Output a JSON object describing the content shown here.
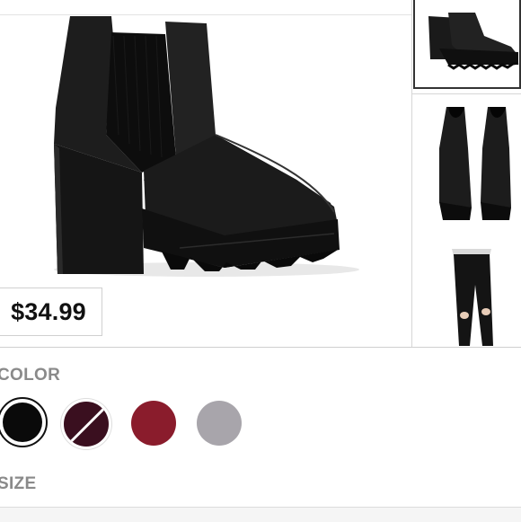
{
  "product": {
    "price": "$34.99",
    "main_image_icon": "chelsea-boot-icon"
  },
  "gallery": {
    "thumbnails": [
      {
        "icon": "boot-side-icon",
        "selected": true
      },
      {
        "icon": "boots-pair-icon",
        "selected": false
      },
      {
        "icon": "ripped-jeans-icon",
        "selected": false
      }
    ]
  },
  "color": {
    "label": "COLOR",
    "swatches": [
      {
        "name": "black",
        "hex": "#0a0a0a",
        "selected": true,
        "available": true
      },
      {
        "name": "dark-burgundy",
        "hex": "#3a0f1f",
        "selected": false,
        "available": false
      },
      {
        "name": "burgundy",
        "hex": "#8a1c2c",
        "selected": false,
        "available": true
      },
      {
        "name": "gray",
        "hex": "#a8a5ab",
        "selected": false,
        "available": true
      }
    ]
  },
  "size": {
    "label": "SIZE"
  }
}
